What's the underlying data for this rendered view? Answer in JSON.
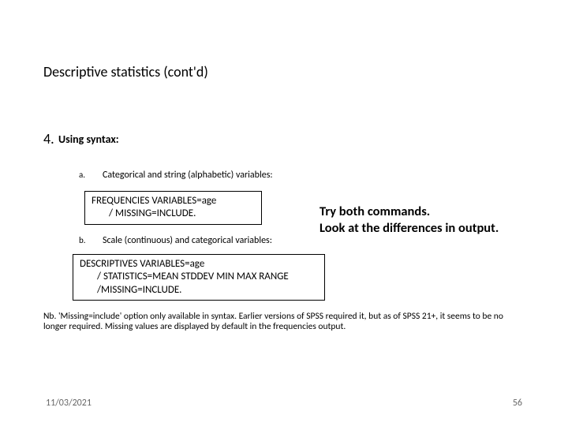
{
  "title": "Descriptive statistics (cont'd)",
  "section": {
    "number": "4.",
    "label": "Using syntax:"
  },
  "items": {
    "a": {
      "marker": "a.",
      "text": "Categorical and string (alphabetic) variables:",
      "code_line1": "FREQUENCIES VARIABLES=age",
      "code_line2": "/ MISSING=INCLUDE."
    },
    "b": {
      "marker": "b.",
      "text": "Scale (continuous) and categorical variables:",
      "code_line1": "DESCRIPTIVES VARIABLES=age",
      "code_line2": "/ STATISTICS=MEAN STDDEV MIN MAX RANGE",
      "code_line3": "/MISSING=INCLUDE."
    }
  },
  "side_note": {
    "line1": "Try both commands.",
    "line2": "Look at the differences in output."
  },
  "nb": "Nb. 'Missing=include' option only available in syntax. Earlier versions of SPSS required it, but as of SPSS 21+, it seems to be no longer required. Missing values are displayed by default in the frequencies output.",
  "footer": {
    "date": "11/03/2021",
    "page": "56"
  }
}
